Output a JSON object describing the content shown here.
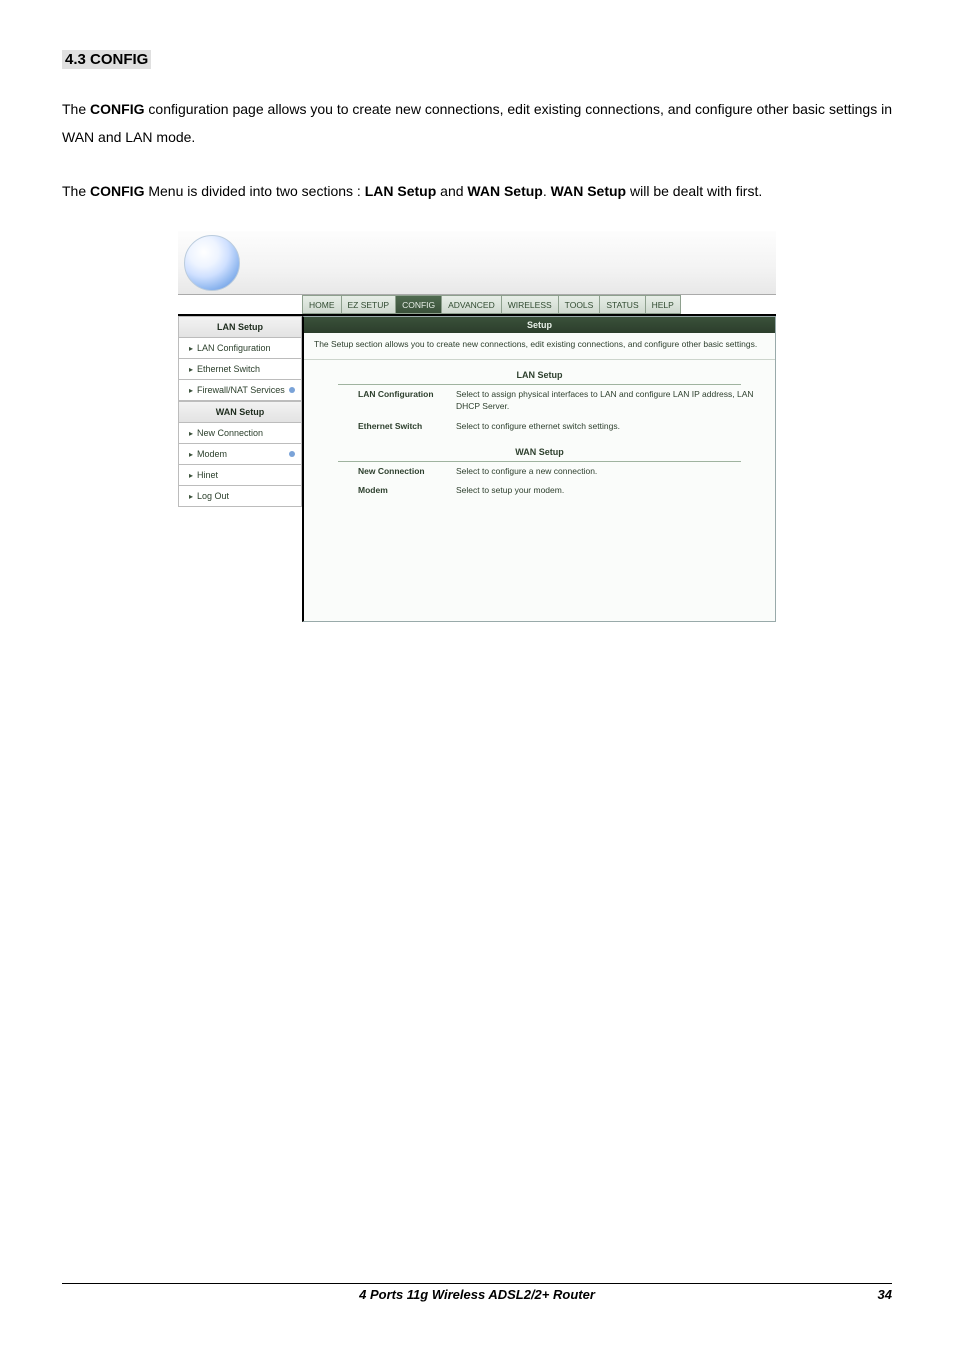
{
  "doc": {
    "section_heading": "4.3 CONFIG",
    "para1_a": "The ",
    "para1_b": "CONFIG",
    "para1_c": " configuration page allows you to create new connections, edit existing connections, and configure other basic settings in WAN and LAN mode.",
    "para2_a": "The ",
    "para2_b": "CONFIG",
    "para2_c": " Menu is divided into two sections : ",
    "para2_d": "LAN Setup",
    "para2_e": " and ",
    "para2_f": "WAN Setup",
    "para2_g": ". ",
    "para2_h": "WAN Setup",
    "para2_i": " will be dealt with first."
  },
  "tabs": {
    "home": "HOME",
    "ezsetup": "EZ SETUP",
    "config": "CONFIG",
    "advanced": "ADVANCED",
    "wireless": "WIRELESS",
    "tools": "TOOLS",
    "status": "STATUS",
    "help": "HELP"
  },
  "sidebar": {
    "lan_setup": "LAN Setup",
    "lan_config": "LAN Configuration",
    "eth_switch": "Ethernet Switch",
    "fw_nat": "Firewall/NAT Services",
    "wan_setup": "WAN Setup",
    "new_conn": "New Connection",
    "modem": "Modem",
    "hinet": "Hinet",
    "logout": "Log Out"
  },
  "content": {
    "title": "Setup",
    "desc": "The Setup section allows you to create new connections, edit existing connections, and configure other basic settings.",
    "lan_setup": "LAN Setup",
    "lan_conf_k": "LAN Configuration",
    "lan_conf_v": "Select to assign physical interfaces to LAN and configure LAN IP address, LAN DHCP Server.",
    "eth_k": "Ethernet Switch",
    "eth_v": "Select to configure ethernet switch settings.",
    "wan_setup": "WAN Setup",
    "newc_k": "New Connection",
    "newc_v": "Select to configure a new connection.",
    "modem_k": "Modem",
    "modem_v": "Select to setup your modem."
  },
  "footer": {
    "title": "4 Ports 11g Wireless ADSL2/2+ Router",
    "page": "34"
  }
}
